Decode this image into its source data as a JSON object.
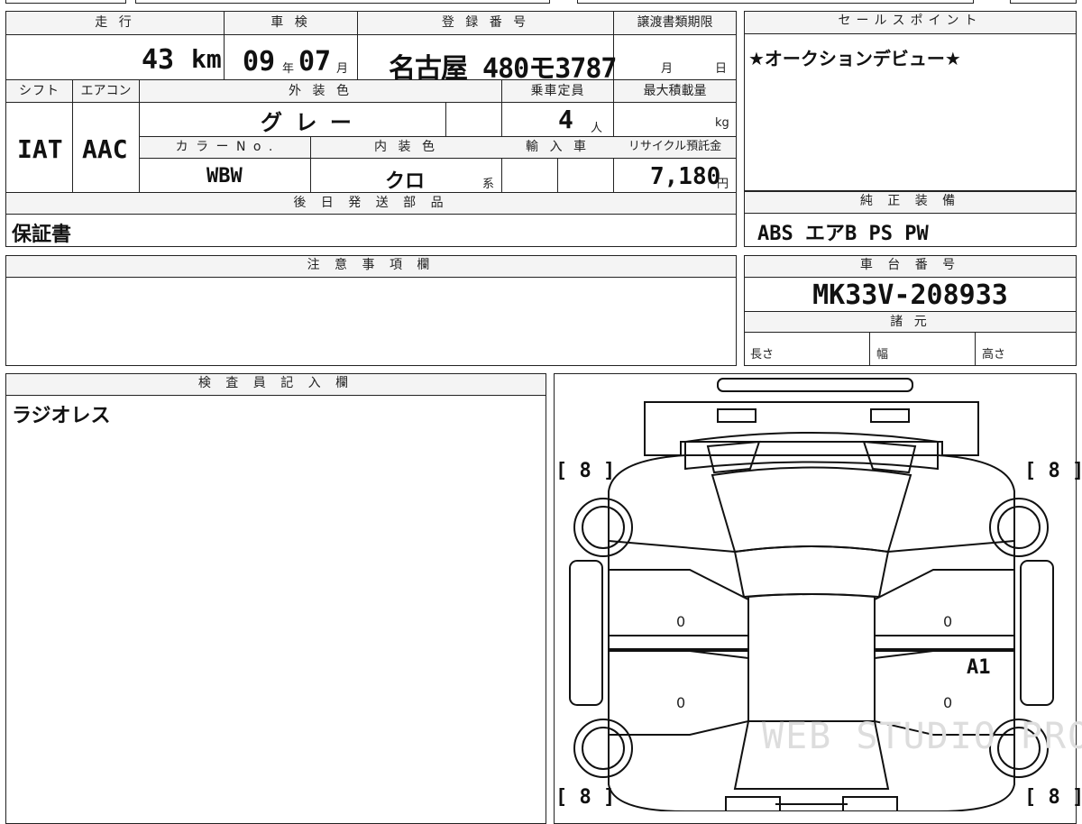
{
  "top": {
    "mileage_label": "走 行",
    "mileage_value": "43",
    "mileage_unit": "km",
    "inspection_label": "車 検",
    "inspection_year": "09",
    "inspection_year_unit": "年",
    "inspection_month": "07",
    "inspection_month_unit": "月",
    "registration_label": "登 録 番 号",
    "registration_value": "名古屋 480モ3787",
    "transfer_deadline_label": "譲渡書類期限",
    "transfer_month_unit": "月",
    "transfer_day_unit": "日"
  },
  "sales_points": {
    "label": "セールスポイント",
    "text": "★オークションデビュー★"
  },
  "row2": {
    "shift_label": "シフト",
    "shift_value": "IAT",
    "aircon_label": "エアコン",
    "aircon_value": "AAC",
    "exterior_color_label": "外 装 色",
    "exterior_color_value": "グ レ ー",
    "capacity_label": "乗車定員",
    "capacity_value": "4",
    "capacity_unit": "人",
    "max_load_label": "最大積載量",
    "max_load_unit": "kg",
    "color_no_label": "カ ラ ー N o .",
    "color_no_value": "WBW",
    "interior_color_label": "内 装 色",
    "interior_color_value": "クロ",
    "interior_color_unit": "系",
    "import_label": "輸 入 車",
    "recycle_label": "リサイクル預託金",
    "recycle_value": "7,180",
    "recycle_unit": "円"
  },
  "later_parts": {
    "label": "後 日 発 送 部 品",
    "value": "保証書"
  },
  "genuine_equipment": {
    "label": "純 正 装 備",
    "value": "ABS エアB PS PW"
  },
  "notes": {
    "label": "注 意 事 項 欄"
  },
  "chassis": {
    "label": "車 台 番 号",
    "value": "MK33V-208933",
    "specs_label": "諸 元",
    "length_label": "長さ",
    "width_label": "幅",
    "height_label": "高さ"
  },
  "inspector": {
    "label": "検 査 員 記 入 欄",
    "text": "ラジオレス"
  },
  "diagram": {
    "tire_tl": "8",
    "tire_tr": "8",
    "tire_bl": "8",
    "tire_br": "8",
    "door_fl": "0",
    "door_fr": "0",
    "door_rl": "0",
    "door_rr": "0",
    "damage_mark": "A1",
    "watermark": "WEB STUDIO PRO"
  }
}
